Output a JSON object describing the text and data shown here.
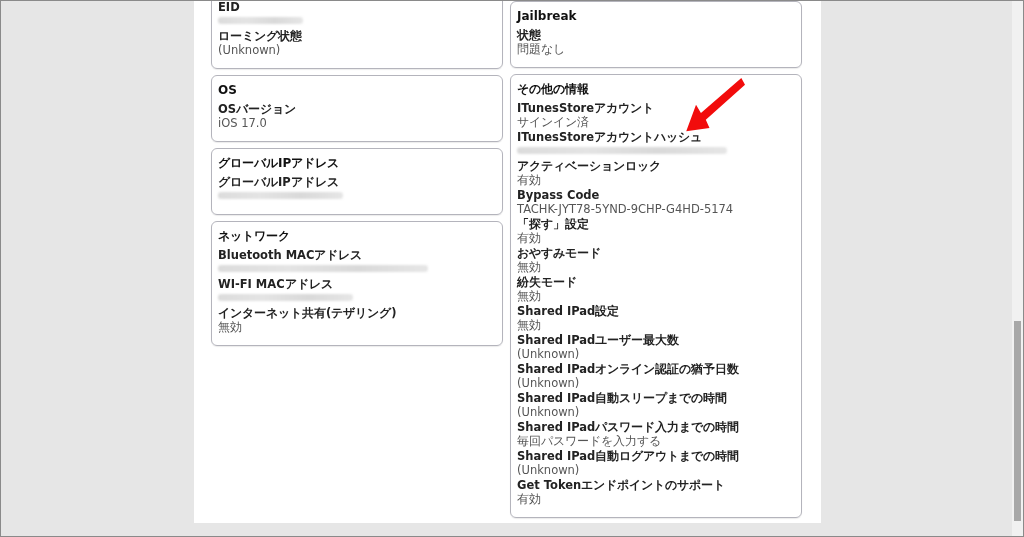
{
  "columns": [
    [
      {
        "fields": [
          {
            "label": "EID",
            "kind": "redacted"
          },
          {
            "label": "ローミング状態",
            "kind": "text",
            "value": "(Unknown)"
          }
        ]
      },
      {
        "title": "OS",
        "fields": [
          {
            "label": "OSバージョン",
            "kind": "text",
            "value": "iOS 17.0"
          }
        ]
      },
      {
        "title": "グローバルIPアドレス",
        "fields": [
          {
            "label": "グローバルIPアドレス",
            "kind": "redacted"
          }
        ]
      },
      {
        "title": "ネットワーク",
        "fields": [
          {
            "label": "Bluetooth MACアドレス",
            "kind": "redacted"
          },
          {
            "label": "WI-FI MACアドレス",
            "kind": "redacted"
          },
          {
            "label": "インターネット共有(テザリング)",
            "kind": "text",
            "value": "無効"
          }
        ]
      }
    ],
    [
      {
        "title": "Jailbreak",
        "fields": [
          {
            "label": "状態",
            "kind": "text",
            "value": "問題なし"
          }
        ]
      },
      {
        "title": "その他の情報",
        "fields": [
          {
            "label": "ITunesStoreアカウント",
            "kind": "text",
            "value": "サインイン済"
          },
          {
            "label": "ITunesStoreアカウントハッシュ",
            "kind": "redacted"
          },
          {
            "label": "アクティベーションロック",
            "kind": "text",
            "value": "有効"
          },
          {
            "label": "Bypass Code",
            "kind": "text",
            "value": "TACHK-JYT78-5YND-9CHP-G4HD-5174"
          },
          {
            "label": "「探す」設定",
            "kind": "text",
            "value": "有効"
          },
          {
            "label": "おやすみモード",
            "kind": "text",
            "value": "無効"
          },
          {
            "label": "紛失モード",
            "kind": "text",
            "value": "無効"
          },
          {
            "label": "Shared IPad設定",
            "kind": "text",
            "value": "無効"
          },
          {
            "label": "Shared IPadユーザー最大数",
            "kind": "text",
            "value": "(Unknown)"
          },
          {
            "label": "Shared IPadオンライン認証の猶予日数",
            "kind": "text",
            "value": "(Unknown)"
          },
          {
            "label": "Shared IPad自動スリープまでの時間",
            "kind": "text",
            "value": "(Unknown)"
          },
          {
            "label": "Shared IPadパスワード入力までの時間",
            "kind": "text",
            "value": "毎回パスワードを入力する"
          },
          {
            "label": "Shared IPad自動ログアウトまでの時間",
            "kind": "text",
            "value": "(Unknown)"
          },
          {
            "label": "Get Tokenエンドポイントのサポート",
            "kind": "text",
            "value": "有効"
          }
        ]
      }
    ]
  ]
}
